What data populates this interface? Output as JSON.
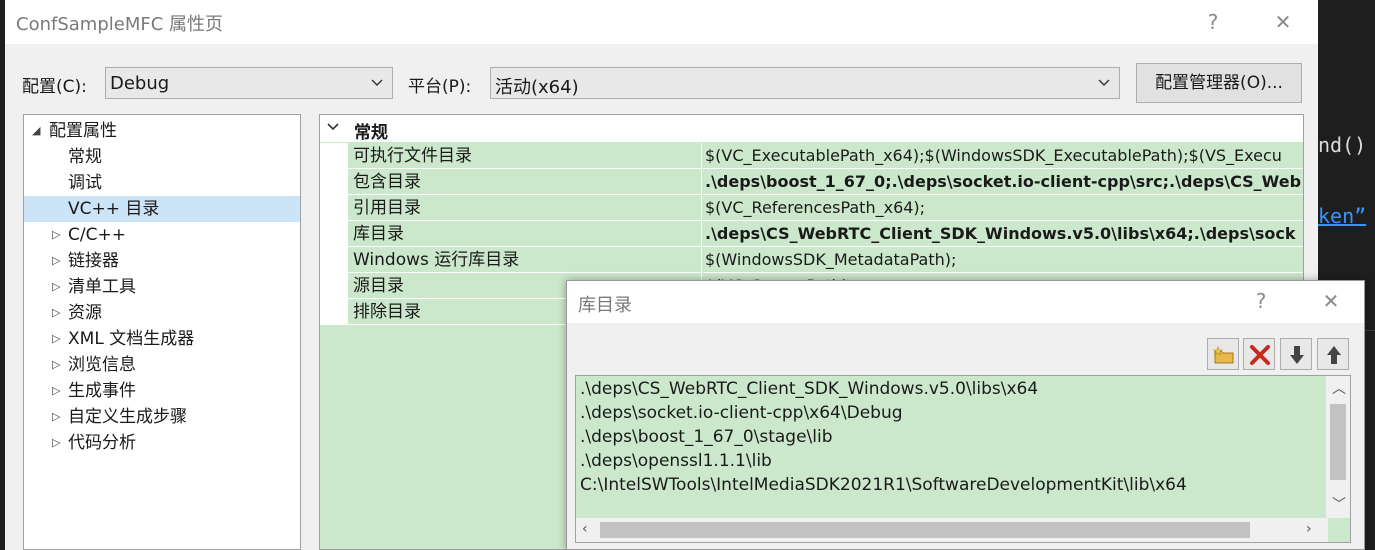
{
  "editor": {
    "code_line_1": "nd()",
    "code_line_2": "ken”"
  },
  "dialog": {
    "title": "ConfSampleMFC 属性页",
    "help_label": "?",
    "close_label": "✕",
    "config_label": "配置(C):",
    "config_value": "Debug",
    "platform_label": "平台(P):",
    "platform_value": "活动(x64)",
    "config_manager_label": "配置管理器(O)..."
  },
  "tree": {
    "root_label": "配置属性",
    "items": [
      {
        "label": "常规",
        "expandable": false,
        "selected": false
      },
      {
        "label": "调试",
        "expandable": false,
        "selected": false
      },
      {
        "label": "VC++ 目录",
        "expandable": false,
        "selected": true
      },
      {
        "label": "C/C++",
        "expandable": true,
        "selected": false
      },
      {
        "label": "链接器",
        "expandable": true,
        "selected": false
      },
      {
        "label": "清单工具",
        "expandable": true,
        "selected": false
      },
      {
        "label": "资源",
        "expandable": true,
        "selected": false
      },
      {
        "label": "XML 文档生成器",
        "expandable": true,
        "selected": false
      },
      {
        "label": "浏览信息",
        "expandable": true,
        "selected": false
      },
      {
        "label": "生成事件",
        "expandable": true,
        "selected": false
      },
      {
        "label": "自定义生成步骤",
        "expandable": true,
        "selected": false
      },
      {
        "label": "代码分析",
        "expandable": true,
        "selected": false
      }
    ]
  },
  "grid": {
    "category": "常规",
    "rows": [
      {
        "name": "可执行文件目录",
        "value": "$(VC_ExecutablePath_x64);$(WindowsSDK_ExecutablePath);$(VS_Execu",
        "bold": false
      },
      {
        "name": "包含目录",
        "value": ".\\deps\\boost_1_67_0;.\\deps\\socket.io-client-cpp\\src;.\\deps\\CS_Web",
        "bold": true
      },
      {
        "name": "引用目录",
        "value": "$(VC_ReferencesPath_x64);",
        "bold": false
      },
      {
        "name": "库目录",
        "value": ".\\deps\\CS_WebRTC_Client_SDK_Windows.v5.0\\libs\\x64;.\\deps\\sock",
        "bold": true
      },
      {
        "name": "Windows 运行库目录",
        "value": "$(WindowsSDK_MetadataPath);",
        "bold": false
      },
      {
        "name": "源目录",
        "value": "$(VC_SourcePath);",
        "bold": false
      },
      {
        "name": "排除目录",
        "value": "",
        "bold": false
      }
    ]
  },
  "subdialog": {
    "title": "库目录",
    "help_label": "?",
    "close_label": "✕",
    "items": [
      ".\\deps\\CS_WebRTC_Client_SDK_Windows.v5.0\\libs\\x64",
      ".\\deps\\socket.io-client-cpp\\x64\\Debug",
      ".\\deps\\boost_1_67_0\\stage\\lib",
      ".\\deps\\openssl1.1.1\\lib",
      "C:\\IntelSWTools\\IntelMediaSDK2021R1\\SoftwareDevelopmentKit\\lib\\x64"
    ]
  },
  "colors": {
    "grid_bg": "#cce8cc",
    "selected_bg": "#cce4f7",
    "delete_red": "#c42b1c"
  }
}
